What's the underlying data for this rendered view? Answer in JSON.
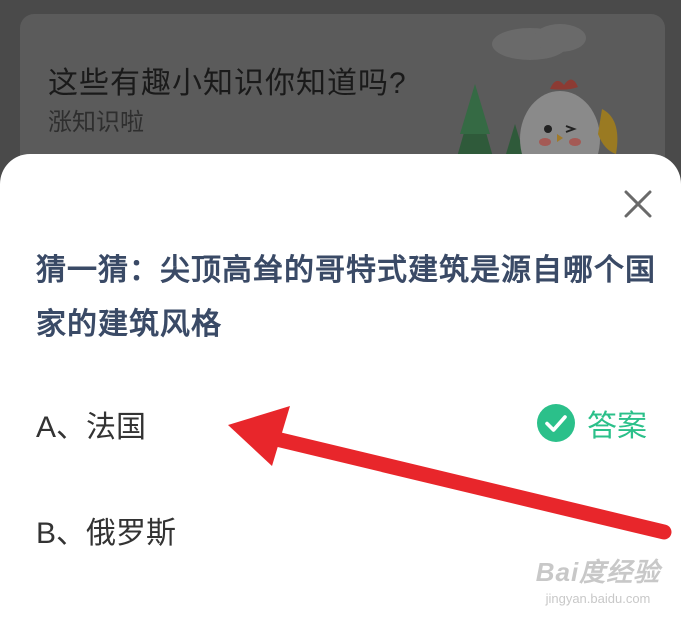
{
  "background_card": {
    "title": "这些有趣小知识你知道吗?",
    "subtitle": "涨知识啦"
  },
  "dialog": {
    "close_icon": "close-icon",
    "question": "猜一猜：尖顶高耸的哥特式建筑是源自哪个国家的建筑风格",
    "options": [
      {
        "label": "A、法国",
        "is_answer": true
      },
      {
        "label": "B、俄罗斯",
        "is_answer": false
      }
    ],
    "answer_badge": {
      "icon": "check-circle-icon",
      "text": "答案"
    }
  },
  "annotation": {
    "icon": "red-arrow",
    "color": "#e8262b"
  },
  "watermark": {
    "logo": "Bai度经验",
    "url": "jingyan.baidu.com"
  },
  "colors": {
    "question_text": "#3a4a66",
    "answer_green": "#2bc08a",
    "overlay": "#4a4a4a"
  }
}
